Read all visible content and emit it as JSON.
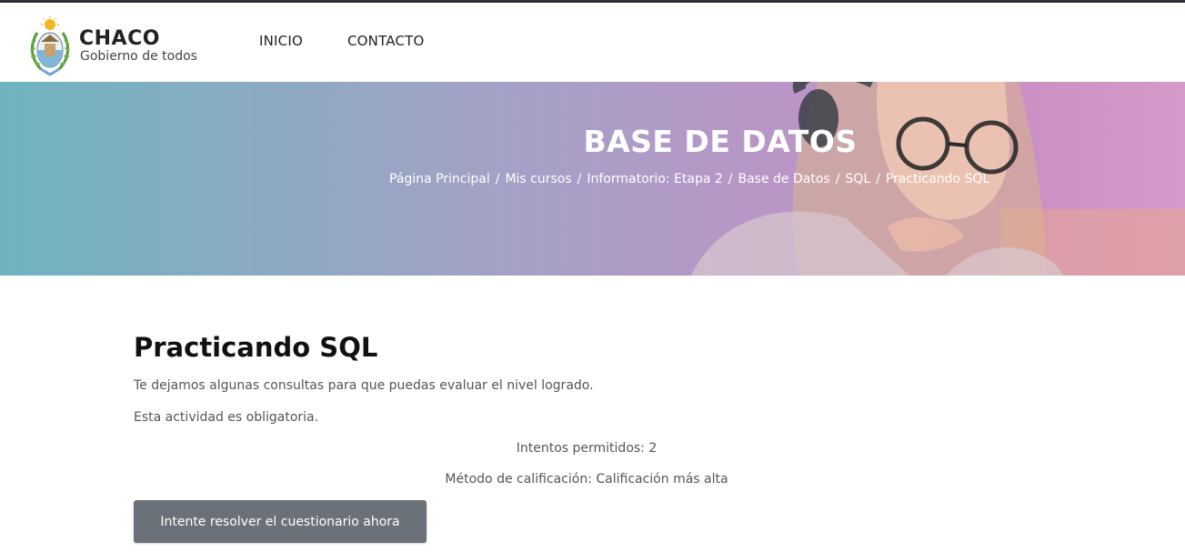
{
  "brand": {
    "name": "CHACO",
    "tagline": "Gobierno de todos"
  },
  "nav": {
    "items": [
      {
        "label": "INICIO"
      },
      {
        "label": "CONTACTO"
      }
    ]
  },
  "hero": {
    "title": "BASE DE DATOS",
    "breadcrumb": [
      {
        "label": "Página Principal"
      },
      {
        "label": "Mis cursos"
      },
      {
        "label": "Informatorio: Etapa 2"
      },
      {
        "label": "Base de Datos"
      },
      {
        "label": "SQL"
      },
      {
        "label": "Practicando SQL"
      }
    ],
    "separator": "/"
  },
  "main": {
    "title": "Practicando SQL",
    "description": "Te dejamos algunas consultas para que puedas evaluar el nivel logrado.",
    "mandatory_note": "Esta actividad es obligatoria.",
    "attempts_allowed": "Intentos permitidos: 2",
    "grading_method": "Método de calificación: Calificación más alta",
    "attempt_button_label": "Intente resolver el cuestionario ahora"
  },
  "colors": {
    "top_bar": "#2b2f36",
    "button_bg": "#6b7178",
    "hero_left": "#6fb4bd",
    "hero_right": "#d49ac8"
  }
}
